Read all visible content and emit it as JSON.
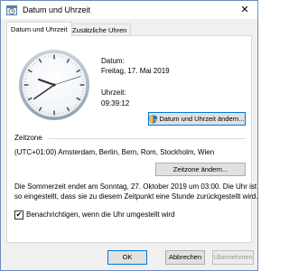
{
  "window": {
    "title": "Datum und Uhrzeit",
    "close_glyph": "✕"
  },
  "tabs": [
    {
      "label": "Datum und Uhrzeit",
      "active": true
    },
    {
      "label": "Zusätzliche Uhren",
      "active": false
    }
  ],
  "datetime": {
    "date_label": "Datum:",
    "date_value": "Freitag, 17. Mai 2019",
    "time_label": "Uhrzeit:",
    "time_value": "09:39:12",
    "change_button": "Datum und Uhrzeit ändern..."
  },
  "clock": {
    "hours": 9,
    "minutes": 39,
    "seconds": 12
  },
  "timezone": {
    "section_label": "Zeitzone",
    "value": "(UTC+01:00) Amsterdam, Berlin, Bern, Rom, Stockholm, Wien",
    "change_button": "Zeitzone ändern..."
  },
  "dst": {
    "line1": "Die Sommerzeit endet am Sonntag, 27. Oktober 2019 um 03:00. Die Uhr ist",
    "line2": "so eingestellt, dass sie zu diesem Zeitpunkt eine Stunde zurückgestellt wird."
  },
  "notify": {
    "label": "Benachrichtigen, wenn die Uhr umgestellt wird",
    "checked": true,
    "check_glyph": "✔"
  },
  "footer": {
    "ok": "OK",
    "cancel": "Abbrechen",
    "apply": "Übernehmen"
  }
}
